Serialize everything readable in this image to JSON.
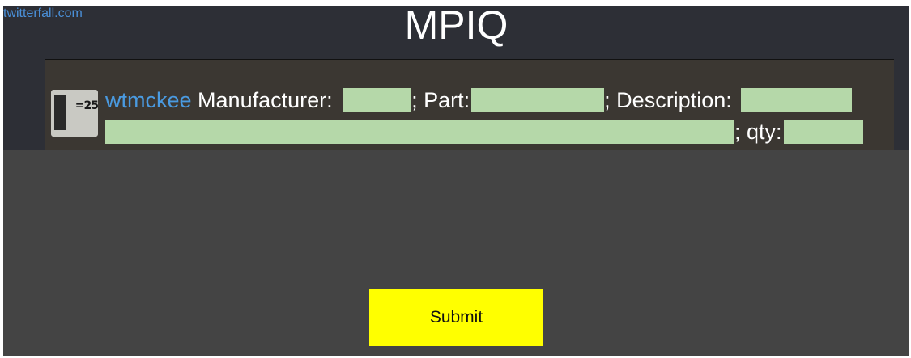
{
  "header": {
    "site_link": "twitterfall.com",
    "title": "MPIQ"
  },
  "tweet": {
    "avatar_text": "=25",
    "username": "wtmckee",
    "fields": {
      "manufacturer_label": "Manufacturer:",
      "part_label": "; Part:",
      "description_label": "; Description:",
      "qty_label": "; qty:"
    },
    "redaction_color": "#b5d8a9"
  },
  "form": {
    "submit_label": "Submit",
    "submit_color": "#ffff00"
  }
}
